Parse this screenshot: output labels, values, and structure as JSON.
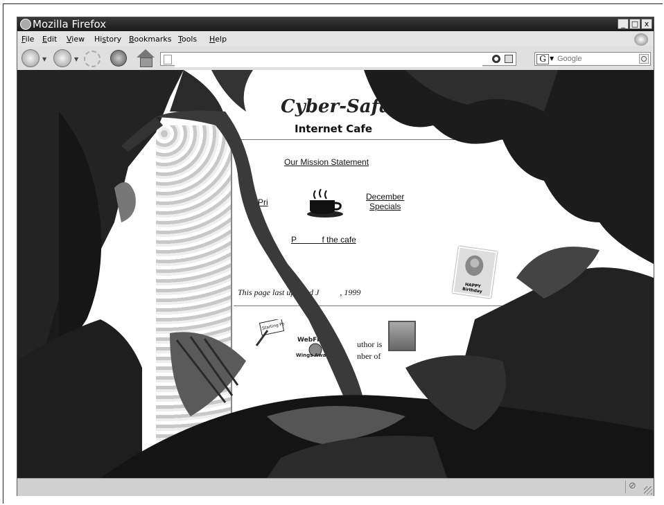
{
  "window": {
    "title": "Mozilla Firefox"
  },
  "window_controls": {
    "minimize": "_",
    "maximize": "□",
    "close": "x"
  },
  "menubar": {
    "items": [
      {
        "key": "F",
        "rest": "ile"
      },
      {
        "key": "E",
        "rest": "dit"
      },
      {
        "key": "V",
        "rest": "iew"
      },
      {
        "key": "s",
        "pre": "Hi",
        "rest": "tory"
      },
      {
        "key": "B",
        "rest": "ookmarks"
      },
      {
        "key": "T",
        "rest": "ools"
      },
      {
        "key": "H",
        "rest": "elp"
      }
    ]
  },
  "toolbar": {
    "url": "",
    "search_engine_letter": "G",
    "search_placeholder": "Google"
  },
  "page": {
    "site_title": "Cyber-Safari",
    "site_subtitle": "Internet Cafe",
    "link_mission": "Our Mission Statement",
    "link_prices": "Pri",
    "link_december_1": "December",
    "link_december_2": "Specials",
    "link_pictures": "P           f the cafe",
    "updated": "This page last updated J          , 1999",
    "award_starting_point": "Starting Point",
    "award_webflyer": "WebFlier's",
    "award_wings": "Wings Awa",
    "author_line_1": "uthor is",
    "author_line_2": "nber of",
    "birthday_card": "HAPPY Birthday"
  },
  "status": {
    "text": ""
  }
}
